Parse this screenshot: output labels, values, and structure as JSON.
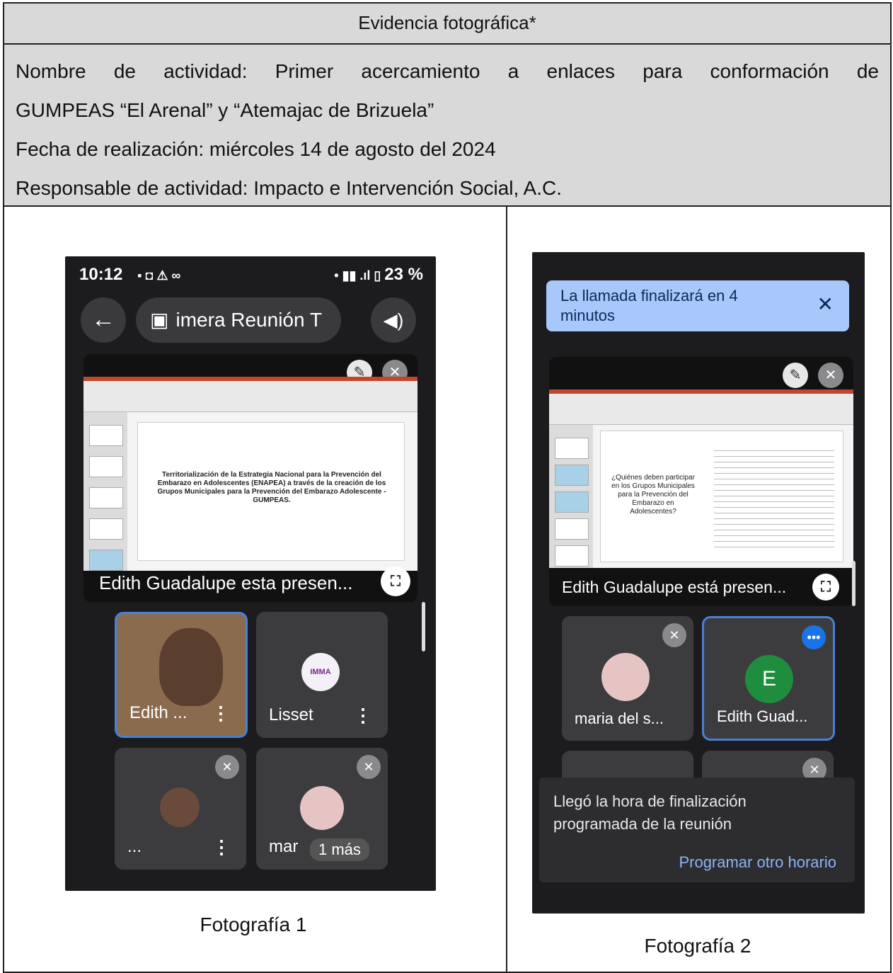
{
  "header": {
    "title": "Evidencia fotográfica*"
  },
  "info": {
    "line1": "Nombre de actividad: Primer acercamiento a enlaces para conformación de",
    "line2": "GUMPEAS  “El Arenal” y “Atemajac de Brizuela”",
    "line3": "Fecha de realización: miércoles 14 de agosto del 2024",
    "line4": "Responsable de actividad: Impacto e Intervención Social, A.C."
  },
  "photo1": {
    "caption": "Fotografía 1",
    "status_time": "10:12",
    "status_battery": "23 %",
    "meeting_title": "imera Reunión T",
    "presenter_label": "Edith Guadalupe esta presen...",
    "tiles": [
      {
        "name": "Edith ..."
      },
      {
        "name": "Lisset",
        "logo_text": "IMMA"
      },
      {
        "name": "..."
      },
      {
        "name": "mar",
        "extra": "1 más"
      }
    ],
    "slide_text": "Territorialización de la Estrategia Nacional para la Prevención del Embarazo en Adolescentes (ENAPEA) a través de la creación de los Grupos Municipales para la Prevención del Embarazo Adolescente - GUMPEAS."
  },
  "photo2": {
    "caption": "Fotografía 2",
    "banner_text": "La llamada finalizará en 4 minutos",
    "presenter_label": "Edith Guadalupe está presen...",
    "slide_text": "¿Quiénes deben participar en los Grupos Municipales para la Prevención del Embarazo en Adolescentes?",
    "tiles": [
      {
        "name": "maria del s..."
      },
      {
        "name": "Edith Guad...",
        "initial": "E"
      }
    ],
    "toast_text": "Llegó la hora de finalización programada de la reunión",
    "toast_action": "Programar otro horario"
  },
  "colors": {
    "header_bg": "#d9d9d9",
    "phone_bg": "#1c1c1e",
    "banner_bg": "#a8c7fa",
    "active_tile_border": "#4a7fd6",
    "avatar_green": "#1e8e3e"
  }
}
